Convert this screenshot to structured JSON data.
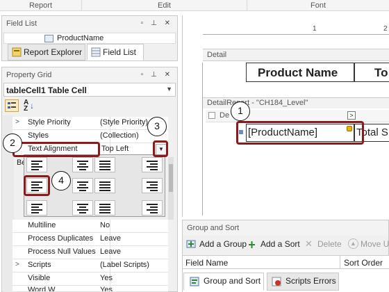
{
  "ribbon": {
    "groups": [
      "Report",
      "Edit",
      "Font"
    ]
  },
  "field_list": {
    "title": "Field List",
    "field": "ProductName",
    "tabs": [
      "Report Explorer",
      "Field List"
    ]
  },
  "property_grid": {
    "title": "Property Grid",
    "selection": "tableCell1  Table Cell",
    "rows": [
      {
        "key": "Style Priority",
        "value": "(Style Priority)",
        "expander": ">"
      },
      {
        "key": "Styles",
        "value": "(Collection)",
        "expander": ""
      },
      {
        "key": "Text Alignment",
        "value": "Top Left",
        "expander": ""
      },
      {
        "key": "Multiline",
        "value": "No",
        "expander": ""
      },
      {
        "key": "Process Duplicates",
        "value": "Leave",
        "expander": ""
      },
      {
        "key": "Process Null Values",
        "value": "Leave",
        "expander": ""
      },
      {
        "key": "Scripts",
        "value": "(Label Scripts)",
        "expander": ">"
      },
      {
        "key": "Visible",
        "value": "Yes",
        "expander": ""
      }
    ],
    "partial_row_left": "Be",
    "partial_bottom_key": "Word W",
    "partial_bottom_value": "Yes"
  },
  "designer": {
    "ruler_numbers": [
      "1",
      "2"
    ],
    "detail_band": "Detail",
    "header_cells": [
      "Product Name",
      "To"
    ],
    "detail_report_band": "DetailReport - \"CH184_Level\"",
    "detail_band_partial": "De",
    "cell_field": "[ProductName]",
    "cell_total": "Total S"
  },
  "group_sort": {
    "title": "Group and Sort",
    "buttons": [
      "Add a Group",
      "Add a Sort",
      "Delete",
      "Move Up"
    ],
    "columns": [
      "Field Name",
      "Sort Order"
    ],
    "tabs": [
      "Group and Sort",
      "Scripts Errors"
    ]
  },
  "callouts": [
    "1",
    "2",
    "3",
    "4"
  ]
}
